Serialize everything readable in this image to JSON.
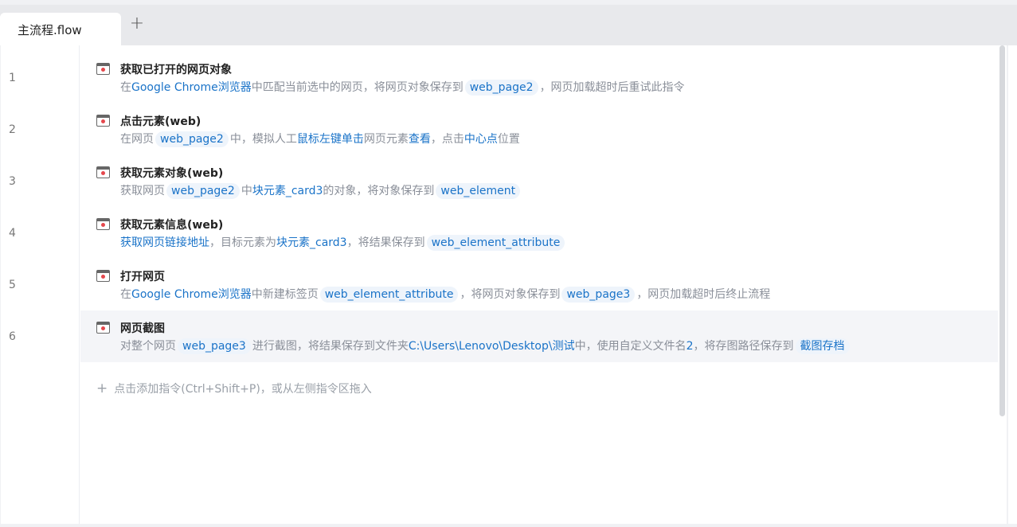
{
  "tabs": {
    "active_label": "主流程.flow",
    "add_label": "+"
  },
  "line_numbers": [
    "1",
    "2",
    "3",
    "4",
    "5",
    "6"
  ],
  "commands": [
    {
      "title": "获取已打开的网页对象",
      "icon": "browser-pick-icon",
      "segments": [
        {
          "t": "t",
          "s": "在"
        },
        {
          "t": "k",
          "s": "Google Chrome浏览器"
        },
        {
          "t": "t",
          "s": "中匹配当前选中的网页，将网页对象保存到"
        },
        {
          "t": "v",
          "s": "web_page2"
        },
        {
          "t": "t",
          "s": "，网页加载超时后重试此指令"
        }
      ]
    },
    {
      "title": "点击元素(web)",
      "icon": "click-element-icon",
      "segments": [
        {
          "t": "t",
          "s": "在网页"
        },
        {
          "t": "v",
          "s": "web_page2"
        },
        {
          "t": "t",
          "s": "中，模拟人工"
        },
        {
          "t": "k",
          "s": "鼠标左键单击"
        },
        {
          "t": "t",
          "s": "网页元素"
        },
        {
          "t": "k",
          "s": "查看"
        },
        {
          "t": "t",
          "s": "，点击"
        },
        {
          "t": "k",
          "s": "中心点"
        },
        {
          "t": "t",
          "s": "位置"
        }
      ]
    },
    {
      "title": "获取元素对象(web)",
      "icon": "element-object-icon",
      "segments": [
        {
          "t": "t",
          "s": "获取网页"
        },
        {
          "t": "v",
          "s": "web_page2"
        },
        {
          "t": "t",
          "s": "中"
        },
        {
          "t": "k",
          "s": "块元素_card3"
        },
        {
          "t": "t",
          "s": "的对象，将对象保存到"
        },
        {
          "t": "v",
          "s": "web_element"
        }
      ]
    },
    {
      "title": "获取元素信息(web)",
      "icon": "element-info-icon",
      "segments": [
        {
          "t": "k",
          "s": "获取网页链接地址"
        },
        {
          "t": "t",
          "s": "，目标元素为"
        },
        {
          "t": "k",
          "s": "块元素_card3"
        },
        {
          "t": "t",
          "s": "，将结果保存到"
        },
        {
          "t": "v",
          "s": "web_element_attribute"
        }
      ]
    },
    {
      "title": "打开网页",
      "icon": "open-page-icon",
      "segments": [
        {
          "t": "t",
          "s": "在"
        },
        {
          "t": "k",
          "s": "Google Chrome浏览器"
        },
        {
          "t": "t",
          "s": "中新建标签页"
        },
        {
          "t": "v",
          "s": "web_element_attribute"
        },
        {
          "t": "t",
          "s": "，将网页对象保存到"
        },
        {
          "t": "v",
          "s": "web_page3"
        },
        {
          "t": "t",
          "s": "，网页加载超时后终止流程"
        }
      ]
    },
    {
      "title": "网页截图",
      "icon": "screenshot-icon",
      "segments": [
        {
          "t": "t",
          "s": "对整个网页"
        },
        {
          "t": "v",
          "s": "web_page3"
        },
        {
          "t": "t",
          "s": "进行截图，将结果保存到文件夹"
        },
        {
          "t": "k",
          "s": "C:\\Users\\Lenovo\\Desktop\\测试"
        },
        {
          "t": "t",
          "s": "中，使用自定义文件名"
        },
        {
          "t": "k",
          "s": "2"
        },
        {
          "t": "t",
          "s": "，将存图路径保存到"
        },
        {
          "t": "v",
          "s": "截图存档"
        }
      ]
    }
  ],
  "add_hint": {
    "plus": "+",
    "text": "点击添加指令(Ctrl+Shift+P)，或从左侧指令区拖入"
  },
  "selected_row": 6
}
